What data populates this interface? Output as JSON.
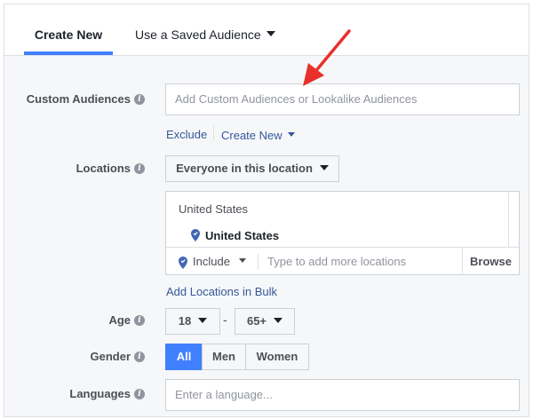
{
  "tabs": {
    "create_new": "Create New",
    "saved_audience": "Use a Saved Audience"
  },
  "custom_audiences": {
    "label": "Custom Audiences",
    "placeholder": "Add Custom Audiences or Lookalike Audiences",
    "exclude": "Exclude",
    "create_new": "Create New"
  },
  "locations": {
    "label": "Locations",
    "mode": "Everyone in this location",
    "group": "United States",
    "item": "United States",
    "include": "Include",
    "placeholder": "Type to add more locations",
    "browse": "Browse",
    "bulk_link": "Add Locations in Bulk"
  },
  "age": {
    "label": "Age",
    "min": "18",
    "separator": "-",
    "max": "65+"
  },
  "gender": {
    "label": "Gender",
    "options": [
      "All",
      "Men",
      "Women"
    ],
    "selected": "All"
  },
  "languages": {
    "label": "Languages",
    "placeholder": "Enter a language..."
  },
  "colors": {
    "accent": "#4080ff",
    "link": "#365899",
    "annotation_arrow": "#e8302a",
    "background": "#f6f7f9"
  }
}
